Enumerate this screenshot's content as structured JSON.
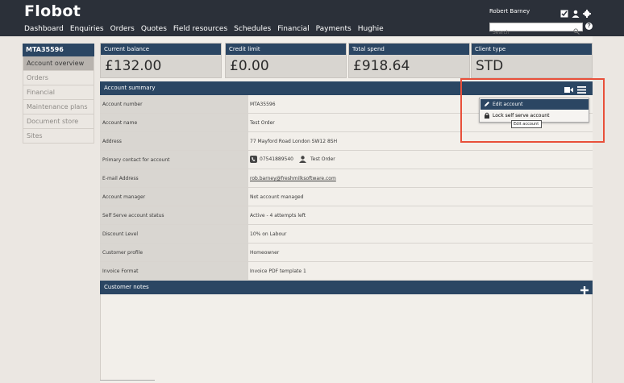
{
  "app": {
    "title": "Flobot"
  },
  "nav": [
    "Dashboard",
    "Enquiries",
    "Orders",
    "Quotes",
    "Field resources",
    "Schedules",
    "Financial",
    "Payments",
    "Hughie"
  ],
  "user": {
    "name": "Robert Barney"
  },
  "search": {
    "placeholder": "Search"
  },
  "sidebar": {
    "account_id": "MTA35596",
    "items": [
      {
        "label": "Account overview",
        "active": true
      },
      {
        "label": "Orders"
      },
      {
        "label": "Financial"
      },
      {
        "label": "Maintenance plans"
      },
      {
        "label": "Document store"
      },
      {
        "label": "Sites"
      }
    ]
  },
  "stats": [
    {
      "label": "Current balance",
      "value": "£132.00"
    },
    {
      "label": "Credit limit",
      "value": "£0.00"
    },
    {
      "label": "Total spend",
      "value": "£918.64"
    },
    {
      "label": "Client type",
      "value": "STD"
    }
  ],
  "summary": {
    "title": "Account summary",
    "rows": [
      {
        "key": "Account number",
        "value": "MTA35596"
      },
      {
        "key": "Account name",
        "value": "Test Order"
      },
      {
        "key": "Address",
        "value": "77 Mayford Road London SW12 8SH"
      },
      {
        "key": "Primary contact for account",
        "phone": "07541889540",
        "contact": "Test Order"
      },
      {
        "key": "E-mail Address",
        "value": "rob.barney@freshmilksoftware.com"
      },
      {
        "key": "Account manager",
        "value": "Not account managed"
      },
      {
        "key": "Self Serve account status",
        "value": "Active - 4 attempts left"
      },
      {
        "key": "Discount Level",
        "value": "10% on Labour"
      },
      {
        "key": "Customer profile",
        "value": "Homeowner"
      },
      {
        "key": "Invoice Format",
        "value": "Invoice PDF template 1"
      }
    ]
  },
  "menu": {
    "items": [
      "Edit account",
      "Lock self serve account"
    ],
    "tooltip": "Edit account"
  },
  "notes": {
    "title": "Customer notes"
  },
  "colors": {
    "header": "#2b4663",
    "topbar": "#2b3039",
    "highlight": "#e8503a"
  }
}
